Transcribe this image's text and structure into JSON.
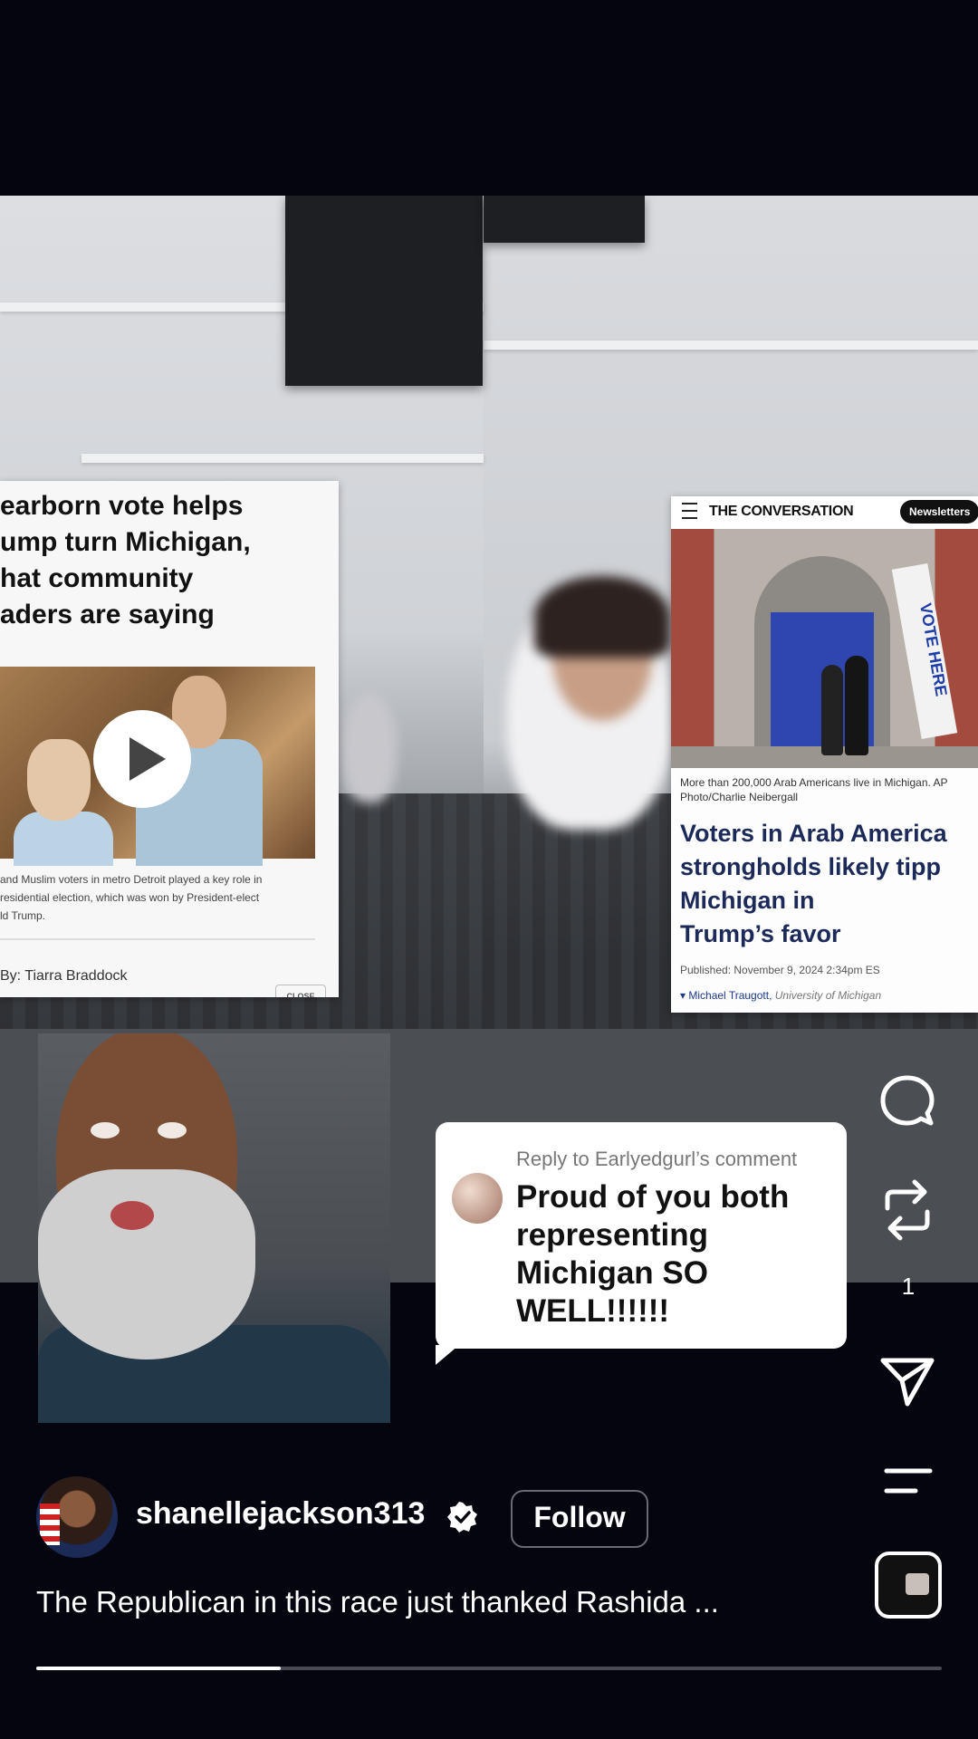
{
  "video": {
    "left_article": {
      "headline": "earborn vote helps\nump turn Michigan,\nhat community\naders are saying",
      "caption": "and Muslim voters in metro Detroit played a key role in\nresidential election, which was won by President-elect\nld Trump.",
      "byline": "By: Tiarra Braddock",
      "close_label": "CLOSE"
    },
    "right_article": {
      "brand": "THE CONVERSATION",
      "newsletters_label": "Newsletters",
      "banner_text": "VOTE HERE",
      "photo_caption": "More than 200,000 Arab Americans live in Michigan. AP\nPhoto/Charlie Neibergall",
      "headline": "Voters in Arab America\nstrongholds likely tipp\nMichigan in\nTrump’s favor",
      "published": "Published: November 9, 2024 2:34pm ES",
      "author": "Michael Traugott",
      "affiliation": "University of Michigan"
    }
  },
  "reply": {
    "meta": "Reply to Earlyedgurl’s comment",
    "text": "Proud of you both\nrepresenting\nMichigan SO\nWELL!!!!!!"
  },
  "rail": {
    "comment_icon": "comment-icon",
    "repost_icon": "repost-icon",
    "repost_count": "1",
    "share_icon": "share-icon",
    "more_icon": "more-icon"
  },
  "post": {
    "username": "shanellejackson313",
    "verified": true,
    "follow_label": "Follow",
    "caption": "The Republican in this race just thanked Rashida ...",
    "progress_fraction": 0.27
  },
  "colors": {
    "background": "#05050f",
    "accent_white": "#ffffff"
  }
}
